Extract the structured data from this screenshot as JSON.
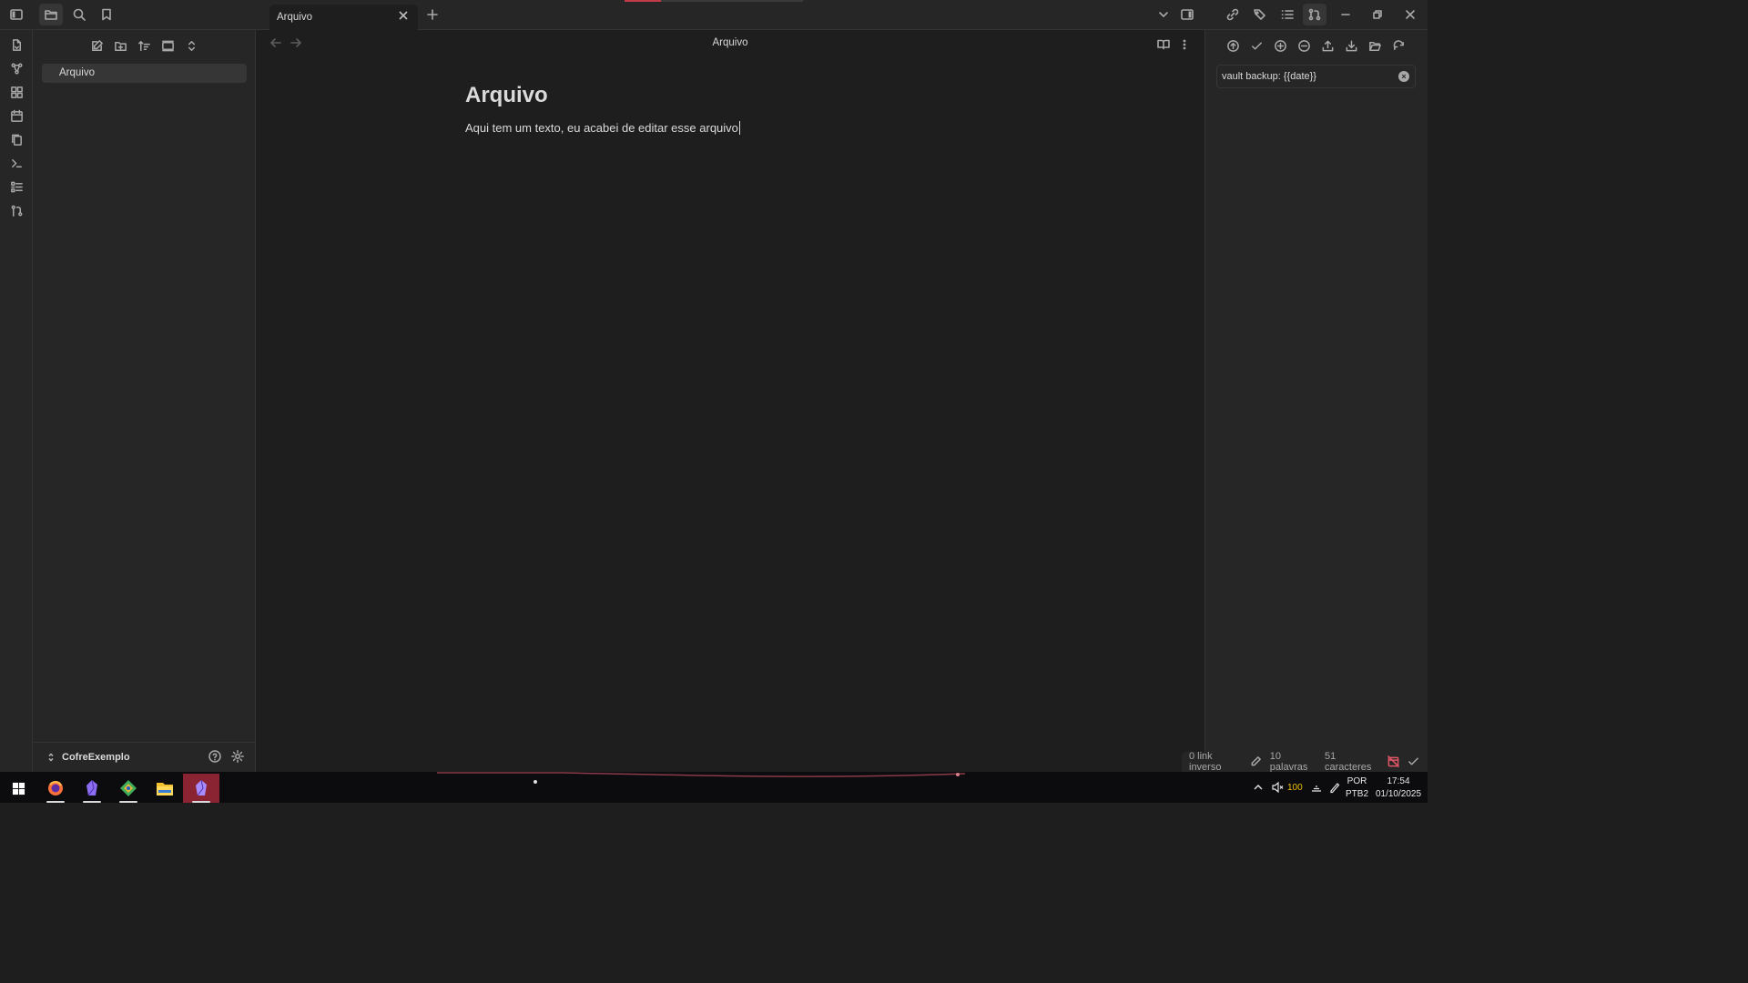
{
  "tab": {
    "title": "Arquivo"
  },
  "file_explorer": {
    "files": [
      "Arquivo"
    ],
    "vault_name": "CofreExemplo"
  },
  "editor": {
    "view_title": "Arquivo",
    "doc_title": "Arquivo",
    "doc_body": "Aqui tem um texto, eu acabei de editar esse arquivo"
  },
  "git_panel": {
    "commit_message": "vault backup: {{date}}"
  },
  "status": {
    "backlinks": "0 link inverso",
    "words": "10 palavras",
    "characters": "51 caracteres"
  },
  "taskbar": {
    "apps": [
      "firefox",
      "obsidian",
      "git",
      "file-explorer",
      "obsidian-active"
    ],
    "volume": "100",
    "lang_top": "POR",
    "lang_bottom": "PTB2",
    "time": "17:54",
    "date": "01/10/2025"
  },
  "colors": {
    "accent": "#8b2432",
    "background": "#1e1e1e",
    "panel": "#262626"
  }
}
